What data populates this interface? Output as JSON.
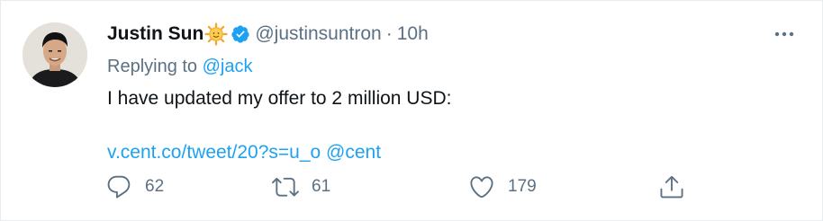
{
  "tweet": {
    "author_name": "Justin Sun",
    "author_handle": "@justinsuntron",
    "separator": "·",
    "time": "10h",
    "replying_prefix": "Replying to",
    "replying_to": "@jack",
    "text": "I have updated my offer to 2 million USD:",
    "link_text": "v.cent.co/tweet/20?s=u_o",
    "link_mention": "@cent"
  },
  "actions": {
    "reply_count": "62",
    "retweet_count": "61",
    "like_count": "179"
  },
  "icons": {
    "author_emoji": "sun-emoji",
    "verified": "verified-badge-icon",
    "more": "more-options-icon",
    "reply": "reply-icon",
    "retweet": "retweet-icon",
    "like": "heart-icon",
    "share": "share-icon"
  },
  "colors": {
    "link": "#1da1f2",
    "secondary_text": "#5b7083",
    "primary_text": "#0f1419",
    "verified": "#1da1f2"
  }
}
